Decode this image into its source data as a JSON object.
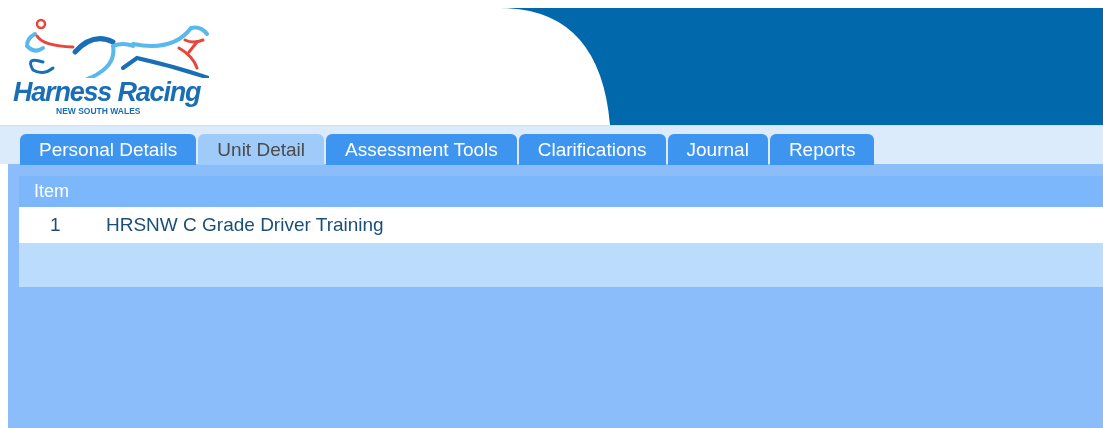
{
  "logo": {
    "title": "Harness Racing",
    "subtitle": "NEW SOUTH WALES"
  },
  "tabs": [
    {
      "label": "Personal Details",
      "selected": false
    },
    {
      "label": "Unit Detail",
      "selected": true
    },
    {
      "label": "Assessment Tools",
      "selected": false
    },
    {
      "label": "Clarifications",
      "selected": false
    },
    {
      "label": "Journal",
      "selected": false
    },
    {
      "label": "Reports",
      "selected": false
    }
  ],
  "table": {
    "columns": [
      "Item"
    ],
    "rows": [
      {
        "number": "1",
        "name": "HRSNW C Grade Driver Training"
      }
    ]
  }
}
